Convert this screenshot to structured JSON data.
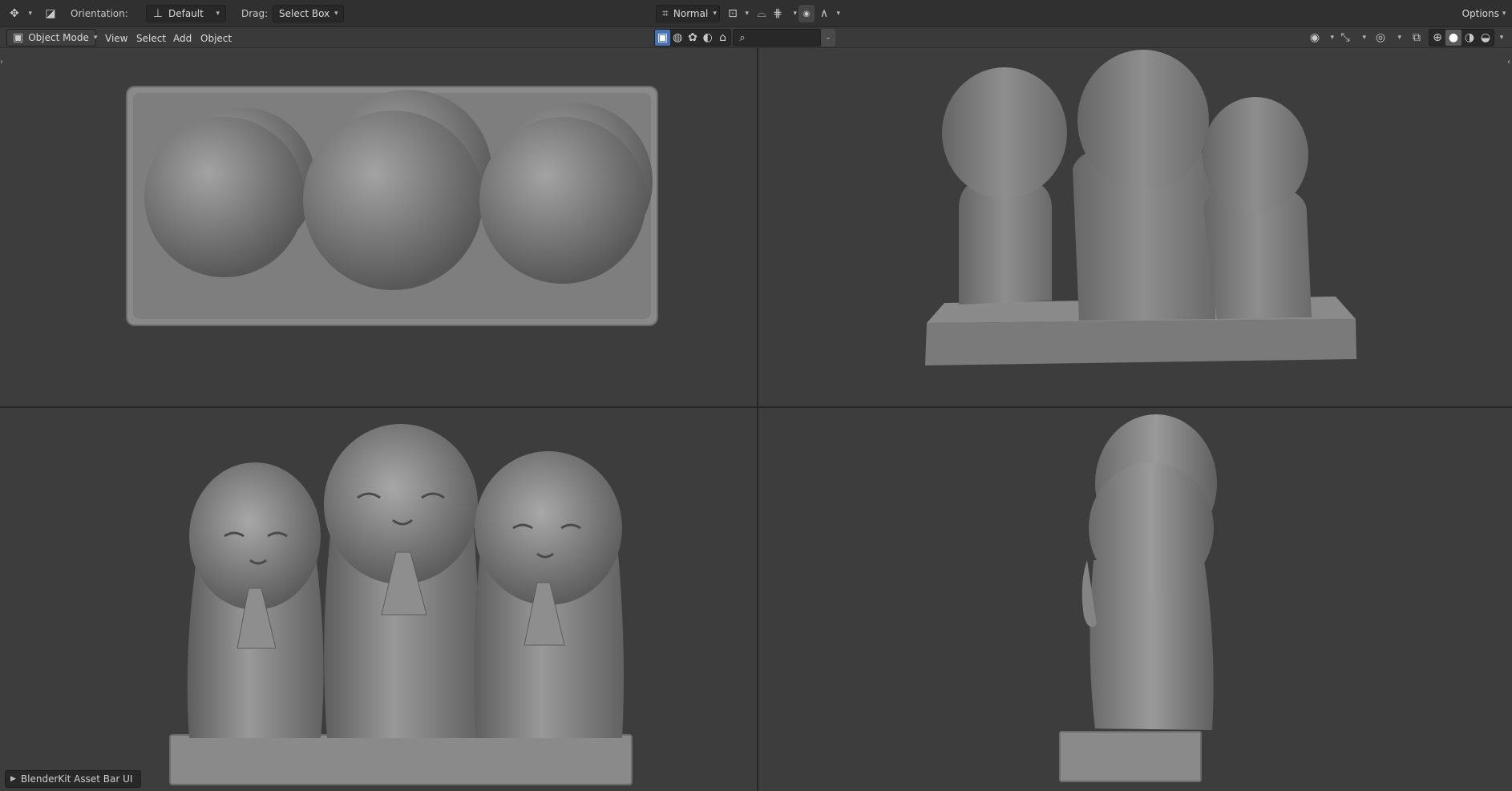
{
  "header": {
    "orientation_label": "Orientation:",
    "orientation_value": "Default",
    "drag_label": "Drag:",
    "drag_value": "Select Box",
    "transform_pivot": "Normal",
    "options_label": "Options"
  },
  "mode_bar": {
    "mode": "Object Mode",
    "menu": [
      "View",
      "Select",
      "Add",
      "Object"
    ]
  },
  "footer": {
    "assetbar_label": "BlenderKit Asset Bar UI"
  },
  "colors": {
    "accent": "#4772b3",
    "header_bg": "#303030",
    "viewport_bg": "#3d3d3d"
  },
  "icons": {
    "editor_type": "transform-gizmo-icon",
    "search": "magnifier-icon",
    "shading": [
      "wireframe-icon",
      "solid-icon",
      "material-icon",
      "rendered-icon"
    ]
  }
}
